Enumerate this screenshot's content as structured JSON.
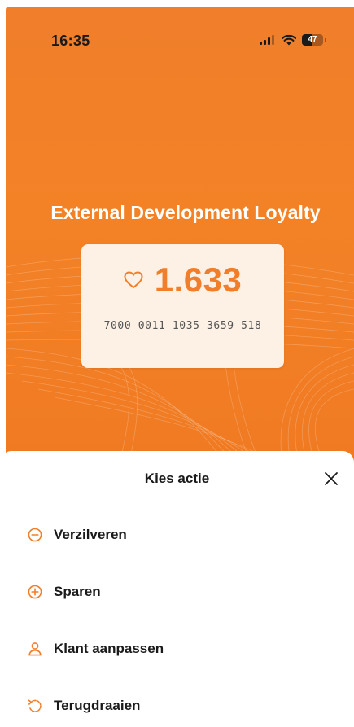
{
  "status_bar": {
    "time": "16:35",
    "battery_percent": 47,
    "battery_label": "47"
  },
  "hero": {
    "title": "External Development Loyalty"
  },
  "card": {
    "points": "1.633",
    "card_number": "7000 0011 1035 3659 518"
  },
  "sheet": {
    "title": "Kies actie",
    "actions": [
      {
        "label": "Verzilveren",
        "icon": "minus-circle-icon"
      },
      {
        "label": "Sparen",
        "icon": "plus-circle-icon"
      },
      {
        "label": "Klant aanpassen",
        "icon": "user-icon"
      },
      {
        "label": "Terugdraaien",
        "icon": "undo-icon"
      }
    ]
  },
  "colors": {
    "brand_orange": "#f07e2a",
    "card_bg": "#fdf1e5",
    "text_dark": "#1a1a1a"
  }
}
